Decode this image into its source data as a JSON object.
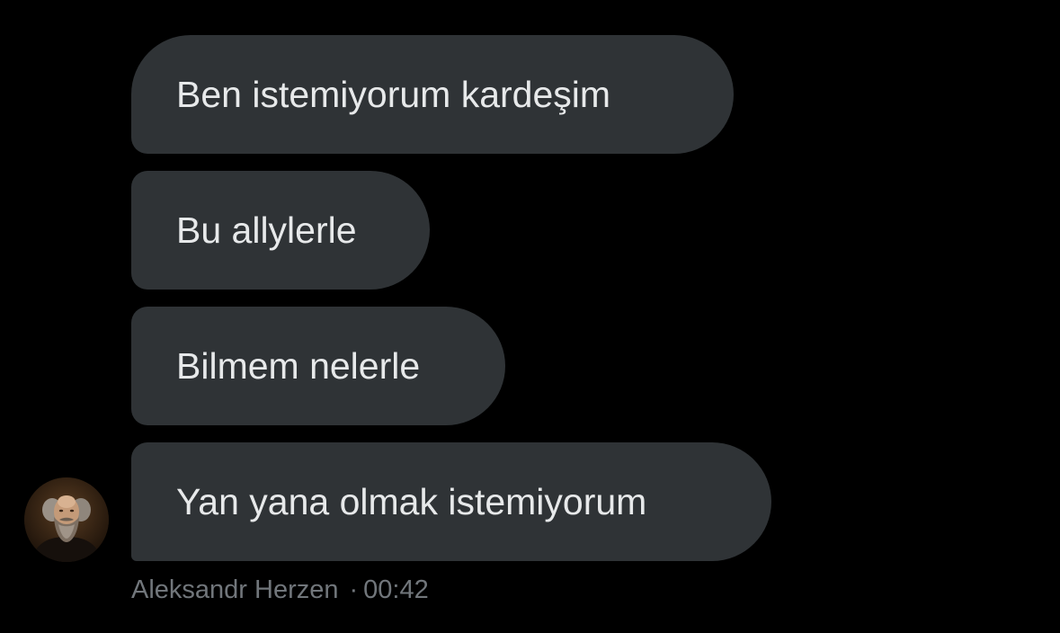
{
  "messages": [
    {
      "text": "Ben istemiyorum kardeşim"
    },
    {
      "text": "Bu allylerle"
    },
    {
      "text": "Bilmem nelerle"
    },
    {
      "text": "Yan yana olmak istemiyorum"
    }
  ],
  "sender": {
    "name": "Aleksandr Herzen",
    "separator": "·",
    "time": "00:42",
    "avatar_icon": "bearded-man-portrait"
  },
  "colors": {
    "background": "#000000",
    "bubble": "#2f3336",
    "bubble_text": "#e7e9ea",
    "meta_text": "#71767b"
  }
}
